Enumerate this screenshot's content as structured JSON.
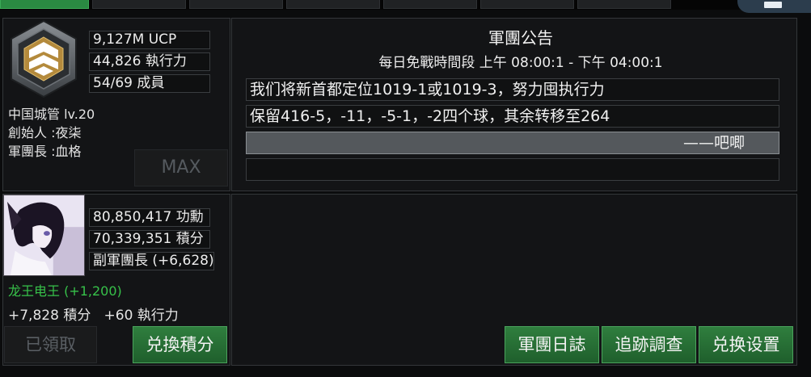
{
  "colors": {
    "accent_green": "#2a8a42",
    "highlight_text": "#37c24a",
    "panel_bg": "#131416"
  },
  "guild": {
    "stats": [
      "9,127M UCP",
      "44,826 執行力",
      "54/69 成員"
    ],
    "name_level": "中国城管 lv.20",
    "founder": "創始人 :夜柒",
    "leader": "軍團長 :血格",
    "max_button": "MAX"
  },
  "notice": {
    "title": "軍團公告",
    "schedule": "每日免戰時間段  上午 08:00:1 - 下午 04:00:1",
    "lines": [
      "我们将新首都定位1019-1或1019-3，努力囤执行力",
      "保留416-5，-11，-5-1，-2四个球，其余转移至264",
      "——吧唧",
      ""
    ]
  },
  "member": {
    "avatar_icon": "anime-character-portrait",
    "stats": [
      "80,850,417 功勳",
      "70,339,351 積分",
      "副軍團長  (+6,628)"
    ],
    "highlight": "龙王电王 (+1,200)",
    "rewards": "+7,828 積分   +60 執行力"
  },
  "buttons": {
    "claimed": "已領取",
    "exchange_points": "兑換積分",
    "guild_log": "軍團日誌",
    "track_investigate": "追跡調查",
    "exchange_settings": "兑换设置"
  }
}
